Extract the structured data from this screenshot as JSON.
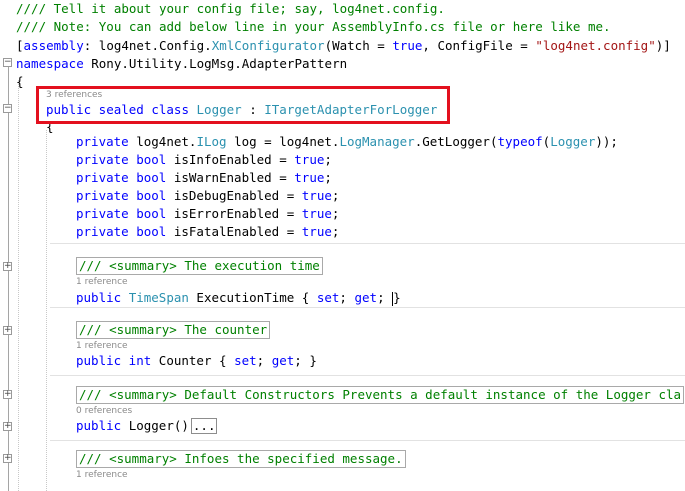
{
  "editor": {
    "lines": [
      {
        "tokens": [
          {
            "c": "t-comment",
            "t": "//// Tell it about your config file; say, log4net.config."
          }
        ]
      },
      {
        "tokens": [
          {
            "c": "t-comment",
            "t": "//// Note: You can add below line in your AssemblyInfo.cs file or here like me."
          }
        ]
      },
      {
        "tokens": [
          {
            "c": "t-plain",
            "t": "["
          },
          {
            "c": "t-kw",
            "t": "assembly"
          },
          {
            "c": "t-plain",
            "t": ": log4net.Config."
          },
          {
            "c": "t-type",
            "t": "XmlConfigurator"
          },
          {
            "c": "t-plain",
            "t": "(Watch = "
          },
          {
            "c": "t-kw",
            "t": "true"
          },
          {
            "c": "t-plain",
            "t": ", ConfigFile = "
          },
          {
            "c": "t-str",
            "t": "\"log4net.config\""
          },
          {
            "c": "t-plain",
            "t": ")]"
          }
        ]
      },
      {
        "tokens": [
          {
            "c": "t-kw",
            "t": "namespace"
          },
          {
            "c": "t-plain",
            "t": " Rony.Utility.LogMsg.AdapterPattern"
          }
        ]
      },
      {
        "tokens": [
          {
            "c": "t-plain",
            "t": "{"
          }
        ]
      },
      {
        "tokens": [
          {
            "c": "t-kw",
            "t": "public sealed class "
          },
          {
            "c": "t-type",
            "t": "Logger"
          },
          {
            "c": "t-plain",
            "t": " : "
          },
          {
            "c": "t-type",
            "t": "ITargetAdapterForLogger"
          }
        ]
      },
      {
        "tokens": [
          {
            "c": "t-plain",
            "t": "{"
          }
        ]
      },
      {
        "tokens": [
          {
            "c": "t-kw",
            "t": "private "
          },
          {
            "c": "t-plain",
            "t": "log4net."
          },
          {
            "c": "t-type",
            "t": "ILog"
          },
          {
            "c": "t-plain",
            "t": " log = log4net."
          },
          {
            "c": "t-type",
            "t": "LogManager"
          },
          {
            "c": "t-plain",
            "t": ".GetLogger("
          },
          {
            "c": "t-kw",
            "t": "typeof"
          },
          {
            "c": "t-plain",
            "t": "("
          },
          {
            "c": "t-type",
            "t": "Logger"
          },
          {
            "c": "t-plain",
            "t": "));"
          }
        ]
      },
      {
        "tokens": [
          {
            "c": "t-kw",
            "t": "private bool "
          },
          {
            "c": "t-plain",
            "t": "isInfoEnabled = "
          },
          {
            "c": "t-kw",
            "t": "true"
          },
          {
            "c": "t-plain",
            "t": ";"
          }
        ]
      },
      {
        "tokens": [
          {
            "c": "t-kw",
            "t": "private bool "
          },
          {
            "c": "t-plain",
            "t": "isWarnEnabled = "
          },
          {
            "c": "t-kw",
            "t": "true"
          },
          {
            "c": "t-plain",
            "t": ";"
          }
        ]
      },
      {
        "tokens": [
          {
            "c": "t-kw",
            "t": "private bool "
          },
          {
            "c": "t-plain",
            "t": "isDebugEnabled = "
          },
          {
            "c": "t-kw",
            "t": "true"
          },
          {
            "c": "t-plain",
            "t": ";"
          }
        ]
      },
      {
        "tokens": [
          {
            "c": "t-kw",
            "t": "private bool "
          },
          {
            "c": "t-plain",
            "t": "isErrorEnabled = "
          },
          {
            "c": "t-kw",
            "t": "true"
          },
          {
            "c": "t-plain",
            "t": ";"
          }
        ]
      },
      {
        "tokens": [
          {
            "c": "t-kw",
            "t": "private bool "
          },
          {
            "c": "t-plain",
            "t": "isFatalEnabled = "
          },
          {
            "c": "t-kw",
            "t": "true"
          },
          {
            "c": "t-plain",
            "t": ";"
          }
        ]
      },
      {
        "tokens": [
          {
            "c": "t-comment",
            "t": "/// <summary> The execution time"
          }
        ],
        "collapsed": true
      },
      {
        "tokens": [
          {
            "c": "t-kw",
            "t": "public "
          },
          {
            "c": "t-type",
            "t": "TimeSpan"
          },
          {
            "c": "t-plain",
            "t": " ExecutionTime { "
          },
          {
            "c": "t-kw",
            "t": "set"
          },
          {
            "c": "t-plain",
            "t": "; "
          },
          {
            "c": "t-kw",
            "t": "get"
          },
          {
            "c": "t-plain",
            "t": "; }"
          }
        ],
        "caret": true
      },
      {
        "tokens": [
          {
            "c": "t-comment",
            "t": "/// <summary> The counter"
          }
        ],
        "collapsed": true
      },
      {
        "tokens": [
          {
            "c": "t-kw",
            "t": "public int "
          },
          {
            "c": "t-plain",
            "t": "Counter { "
          },
          {
            "c": "t-kw",
            "t": "set"
          },
          {
            "c": "t-plain",
            "t": "; "
          },
          {
            "c": "t-kw",
            "t": "get"
          },
          {
            "c": "t-plain",
            "t": "; }"
          }
        ]
      },
      {
        "tokens": [
          {
            "c": "t-comment",
            "t": "/// <summary> Default Constructors Prevents a default instance of the Logger cla"
          }
        ],
        "collapsed": true
      },
      {
        "tokens": [
          {
            "c": "t-kw",
            "t": "public "
          },
          {
            "c": "t-plain",
            "t": "Logger()"
          }
        ],
        "ellipsis": "..."
      },
      {
        "tokens": [
          {
            "c": "t-comment",
            "t": "/// <summary> Infoes the specified message."
          }
        ],
        "collapsed": true
      }
    ],
    "lenses": [
      "3 references",
      "1 reference",
      "1 reference",
      "0 references",
      "1 reference"
    ]
  }
}
